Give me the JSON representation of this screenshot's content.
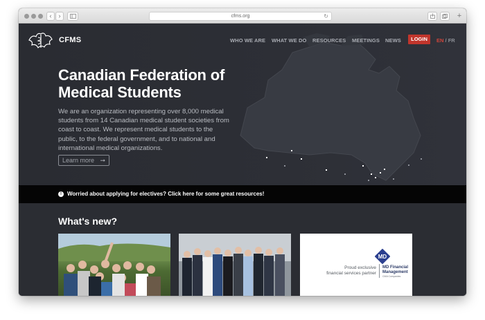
{
  "browser": {
    "url": "cfms.org",
    "reload_icon": "reload-icon",
    "back_icon": "chevron-left-icon",
    "forward_icon": "chevron-right-icon",
    "sidebar_icon": "sidebar-icon",
    "share_icon": "share-icon",
    "tabs_icon": "tabs-icon"
  },
  "header": {
    "brand": "CFMS",
    "nav": [
      "WHO WE ARE",
      "WHAT WE DO",
      "RESOURCES",
      "MEETINGS",
      "NEWS"
    ],
    "login": "LOGIN",
    "lang_active": "EN",
    "lang_sep": " / ",
    "lang_other": "FR"
  },
  "hero": {
    "title_line1": "Canadian Federation of",
    "title_line2": "Medical Students",
    "description": "We are an organization representing over 8,000 medical students from 14 Canadian medical student societies from coast to coast. We represent medical students to the public, to the federal government, and to national and international medical organizations.",
    "learn_more": "Learn more",
    "learn_more_arrow": "➞"
  },
  "banner": {
    "icon": "!",
    "text": "Worried about applying for electives? Click here for some great resources!"
  },
  "news": {
    "heading": "What's new?",
    "partner_text_line1": "Proud exclusive",
    "partner_text_line2": "financial services partner",
    "md_logo_text": "MD",
    "md_name_line1": "MD Financial",
    "md_name_line2": "Management",
    "md_sub": "CMA Companies"
  },
  "colors": {
    "hero_bg": "#2b2d33",
    "accent_red": "#c1352c",
    "banner_bg": "#050505",
    "md_blue": "#2b3f8f"
  }
}
